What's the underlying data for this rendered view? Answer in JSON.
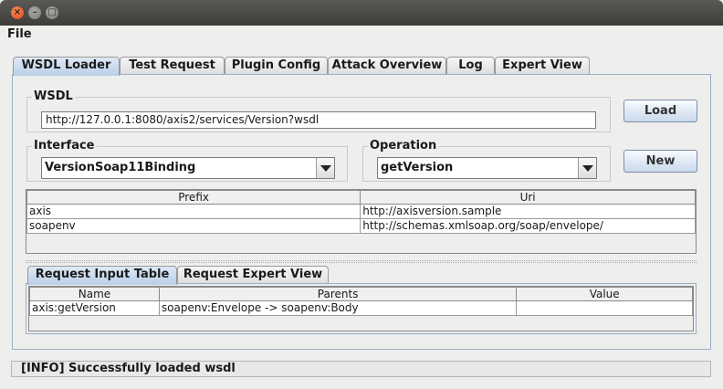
{
  "window": {
    "close_glyph": "×",
    "min_glyph": "–",
    "max_glyph": "□"
  },
  "menu": {
    "file": "File"
  },
  "tabs": [
    "WSDL Loader",
    "Test Request",
    "Plugin Config",
    "Attack Overview",
    "Log",
    "Expert View"
  ],
  "wsdl": {
    "group_label": "WSDL",
    "url": "http://127.0.0.1:8080/axis2/services/Version?wsdl",
    "load_button": "Load"
  },
  "interface": {
    "label": "Interface",
    "value": "VersionSoap11Binding"
  },
  "operation": {
    "label": "Operation",
    "value": "getVersion"
  },
  "new_button": "New",
  "namespaces": {
    "headers": [
      "Prefix",
      "Uri"
    ],
    "rows": [
      [
        "axis",
        "http://axisversion.sample"
      ],
      [
        "soapenv",
        "http://schemas.xmlsoap.org/soap/envelope/"
      ]
    ]
  },
  "request_tabs": [
    "Request Input Table",
    "Request Expert View"
  ],
  "request_table": {
    "headers": [
      "Name",
      "Parents",
      "Value"
    ],
    "rows": [
      [
        "axis:getVersion",
        "soapenv:Envelope -> soapenv:Body",
        ""
      ]
    ]
  },
  "status": "[INFO] Successfully loaded wsdl",
  "colors": {
    "active_tab": "#b9cfe8",
    "button": "#c9d9ec",
    "panel_border": "#9aaec8"
  }
}
